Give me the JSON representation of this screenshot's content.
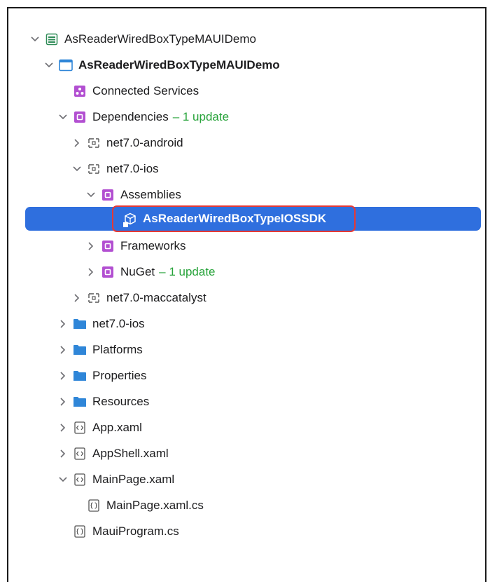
{
  "tree": {
    "solution": {
      "label": "AsReaderWiredBoxTypeMAUIDemo"
    },
    "project": {
      "label": "AsReaderWiredBoxTypeMAUIDemo"
    },
    "connected_services": {
      "label": "Connected Services"
    },
    "dependencies": {
      "label": "Dependencies",
      "badge": "– 1 update"
    },
    "net7_android": {
      "label": "net7.0-android"
    },
    "net7_ios_dep": {
      "label": "net7.0-ios"
    },
    "assemblies": {
      "label": "Assemblies"
    },
    "sdk": {
      "label": "AsReaderWiredBoxTypeIOSSDK"
    },
    "frameworks": {
      "label": "Frameworks"
    },
    "nuget": {
      "label": "NuGet",
      "badge": "– 1 update"
    },
    "net7_maccatalyst": {
      "label": "net7.0-maccatalyst"
    },
    "net7_ios_folder": {
      "label": "net7.0-ios"
    },
    "platforms": {
      "label": "Platforms"
    },
    "properties": {
      "label": "Properties"
    },
    "resources": {
      "label": "Resources"
    },
    "app_xaml": {
      "label": "App.xaml"
    },
    "appshell_xaml": {
      "label": "AppShell.xaml"
    },
    "mainpage_xaml": {
      "label": "MainPage.xaml"
    },
    "mainpage_cs": {
      "label": "MainPage.xaml.cs"
    },
    "mauiprogram_cs": {
      "label": "MauiProgram.cs"
    }
  },
  "icons": {
    "solution": "solution-icon",
    "project": "project-window-icon",
    "connected_services": "connected-services-icon",
    "dependency": "dependencies-icon",
    "framework_target": "target-framework-icon",
    "assembly": "assembly-cube-icon",
    "folder": "folder-icon",
    "xaml_file": "xaml-file-icon",
    "cs_file": "csharp-file-icon"
  },
  "colors": {
    "selection": "#2f6fde",
    "highlight_outline": "#e53935",
    "update_badge": "#27a33a",
    "dependency_purple": "#b24fd1",
    "folder_blue": "#2f86d8"
  }
}
